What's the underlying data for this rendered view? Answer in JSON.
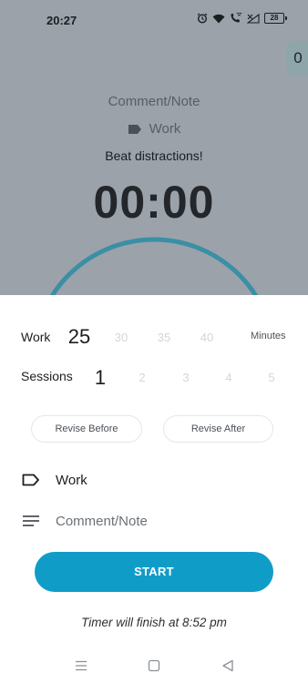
{
  "status_bar": {
    "time": "20:27",
    "battery": "28",
    "icons": [
      "alarm-icon",
      "wifi-icon",
      "wifi-calling-icon",
      "signal-off-icon",
      "battery-icon"
    ]
  },
  "side_tab": {
    "count": "0"
  },
  "background_timer": {
    "note": "Comment/Note",
    "tag": "Work",
    "quote": "Beat distractions!",
    "time": "00:00",
    "ring_color": "#3a8fa5"
  },
  "work_picker": {
    "label": "Work",
    "selected": "25",
    "options": [
      "30",
      "35",
      "40"
    ],
    "unit": "Minutes"
  },
  "sessions_picker": {
    "label": "Sessions",
    "selected": "1",
    "options": [
      "2",
      "3",
      "4",
      "5"
    ]
  },
  "revise_before": "Revise Before",
  "revise_after": "Revise After",
  "tag_row": {
    "value": "Work",
    "icon": "label-icon"
  },
  "note_row": {
    "placeholder": "Comment/Note",
    "icon": "notes-icon"
  },
  "start_button": "START",
  "finish_text": "Timer will finish at 8:52 pm",
  "colors": {
    "accent": "#0f9dc8",
    "overlay": "#9ba2aa"
  },
  "nav_bar": {
    "icons": [
      "menu-icon",
      "home-icon",
      "back-icon"
    ]
  }
}
